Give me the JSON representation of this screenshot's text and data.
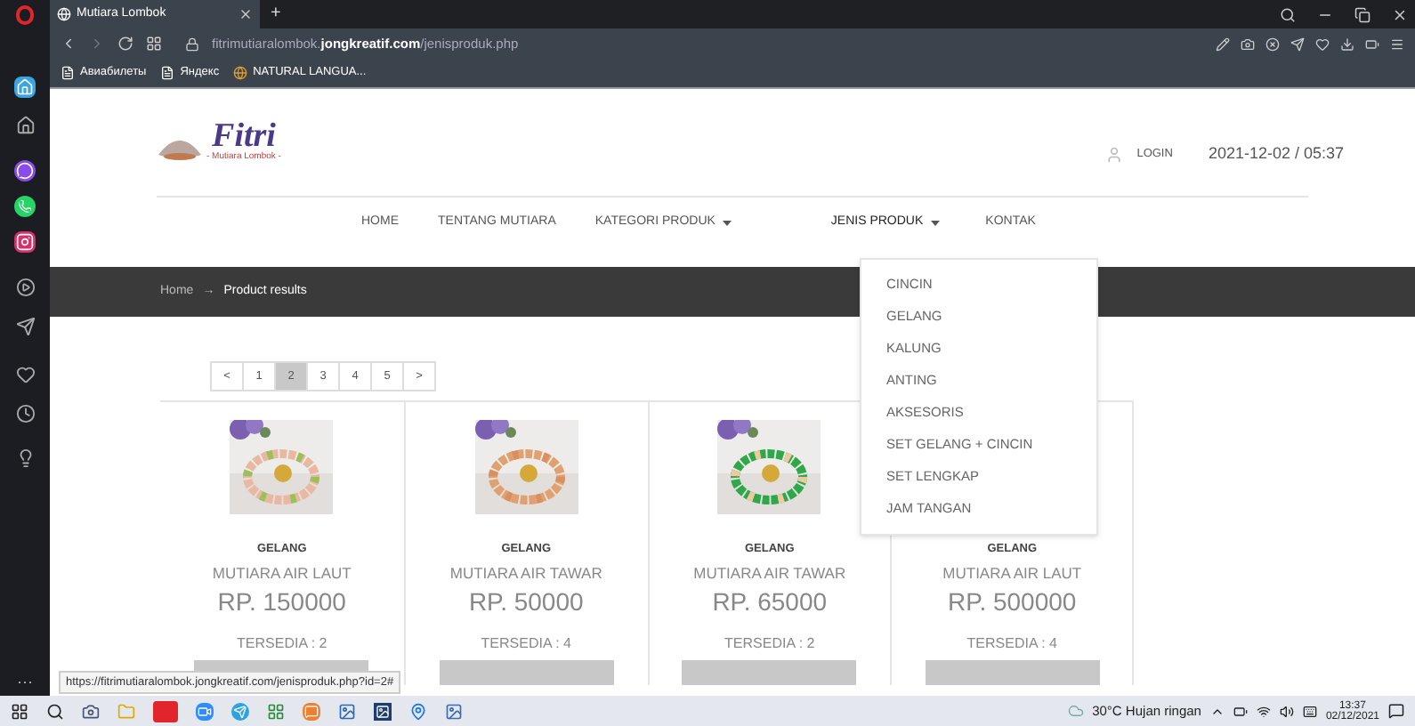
{
  "browser": {
    "tab_title": "Mutiara Lombok",
    "new_tab": "+",
    "url": "fitrimutiaralombok.**jongkreatif.com**/jenisproduk.php",
    "bookmarks": [
      "Авиабилеты",
      "Яндекс",
      "NATURAL LANGUA..."
    ]
  },
  "sidebar_more": "···",
  "logo": {
    "name": "Fitri",
    "tagline": "- Mutiara Lombok -"
  },
  "header": {
    "login": "LOGIN",
    "datetime": "2021-12-02 / 05:37"
  },
  "nav": [
    {
      "label": "HOME",
      "dropdown": false,
      "selected": false
    },
    {
      "label": "TENTANG MUTIARA",
      "dropdown": false,
      "selected": false
    },
    {
      "label": "KATEGORI PRODUK",
      "dropdown": true,
      "selected": false
    },
    {
      "label": "JENIS PRODUK",
      "dropdown": true,
      "selected": true
    },
    {
      "label": "KONTAK",
      "dropdown": false,
      "selected": false
    }
  ],
  "dropdown": [
    "CINCIN",
    "GELANG",
    "KALUNG",
    "ANTING",
    "AKSESORIS",
    "SET GELANG + CINCIN",
    "SET LENGKAP",
    "JAM TANGAN"
  ],
  "breadcrumb": {
    "home": "Home",
    "arrow": "→",
    "current": "Product results"
  },
  "pagination": {
    "prev": "<",
    "next": ">",
    "pages": [
      {
        "label": "1",
        "selected": false
      },
      {
        "label": "2",
        "selected": true
      },
      {
        "label": "3",
        "selected": false
      },
      {
        "label": "4",
        "selected": false
      },
      {
        "label": "5",
        "selected": false
      }
    ]
  },
  "products": [
    {
      "category": "GELANG",
      "name": "MUTIARA AIR LAUT",
      "price": "RP. 150000",
      "stock": "TERSEDIA : 2"
    },
    {
      "category": "GELANG",
      "name": "MUTIARA AIR TAWAR",
      "price": "RP. 50000",
      "stock": "TERSEDIA : 4"
    },
    {
      "category": "GELANG",
      "name": "MUTIARA AIR TAWAR",
      "price": "RP. 65000",
      "stock": "TERSEDIA : 2"
    },
    {
      "category": "GELANG",
      "name": "MUTIARA AIR LAUT",
      "price": "RP. 500000",
      "stock": "TERSEDIA : 4"
    }
  ],
  "status_url": "https://fitrimutiaralombok.jongkreatif.com/jenisproduk.php?id=2#",
  "taskbar": {
    "weather": "30°C Hujan ringan",
    "time": "13:37",
    "date": "02/12/2021"
  }
}
